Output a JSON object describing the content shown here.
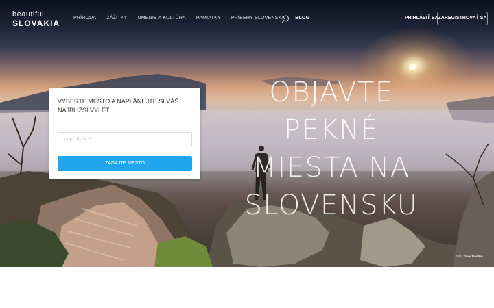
{
  "nav": {
    "logo_line1": "beautiful",
    "logo_line2": "SLOVAKIA",
    "items": [
      {
        "label": "PRÍRODA"
      },
      {
        "label": "ZÁŽITKY"
      },
      {
        "label": "UMENIE A KULTÚRA"
      },
      {
        "label": "PAMIATKY"
      },
      {
        "label": "PRÍBEHY SLOVENSKA"
      },
      {
        "label": "BLOG",
        "active": true
      }
    ],
    "search_icon": "search-icon",
    "login_label": "PRIHLÁSIŤ SA",
    "register_label": "ZAREGISTROVAŤ SA"
  },
  "hero": {
    "headline_lines": [
      "OBJAVTE PEKNÉ",
      "MIESTA NA",
      "SLOVENSKU"
    ],
    "credit_prefix": "Foto:",
    "credit_author": "Tibor Rendek"
  },
  "search_card": {
    "title": "VYBERTE MESTO A NAPLÁNUJTE SI VÁŠ NAJBLIŽŠÍ VÝLET",
    "input_value": "",
    "input_placeholder": "napr. Košice",
    "button_label": "ZADAJTE MESTO"
  },
  "colors": {
    "accent": "#20a6ee",
    "nav_text": "#dfe3ea",
    "card_bg": "#ffffff"
  }
}
